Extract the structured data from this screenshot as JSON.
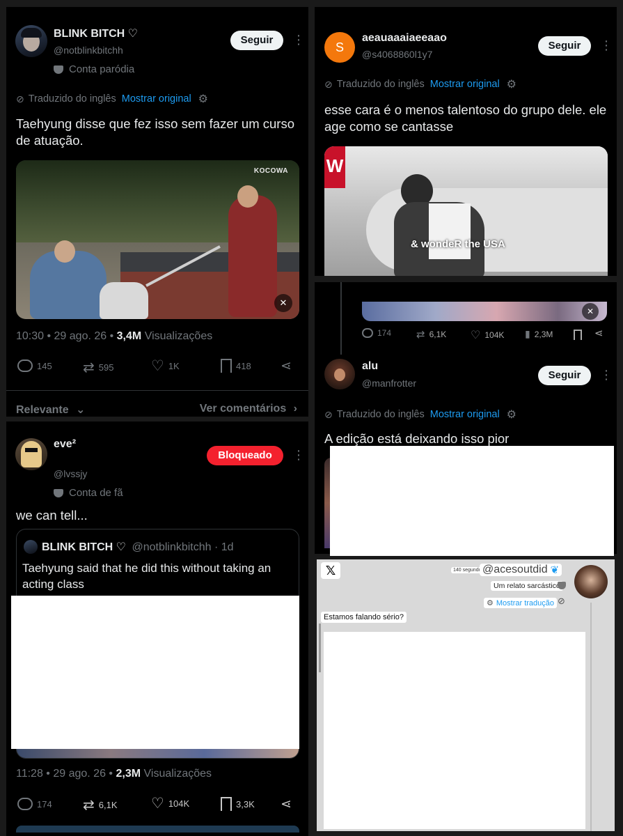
{
  "post1": {
    "name": "BLINK BITCH ♡",
    "handle": "@notblinkbitchh",
    "label": "Conta paródia",
    "follow": "Seguir",
    "translated": "Traduzido do inglês",
    "show_original": "Mostrar original",
    "text": "Taehyung disse que fez isso sem fazer um curso de atuação.",
    "video_watermark": "KOCOWA",
    "time": "10:30 • 29 ago. 26 •",
    "views_count": "3,4M",
    "views_label": "Visualizações",
    "replies": "145",
    "reposts": "595",
    "likes": "1K",
    "bookmarks": "418",
    "sort_label": "Relevante",
    "view_comments": "Ver comentários"
  },
  "post2": {
    "avatar_letter": "S",
    "name": "aeauaaaiaeeaao",
    "handle": "@s4068860l1y7",
    "follow": "Seguir",
    "translated": "Traduzido do inglês",
    "show_original": "Mostrar original",
    "text": "esse cara é o menos talentoso do grupo dele. ele age como se cantasse",
    "video_caption": "& wondeR the USA",
    "brand_letter": "W"
  },
  "post3": {
    "replies": "174",
    "reposts": "6,1K",
    "likes": "104K",
    "views": "2,3M",
    "name": "alu",
    "handle": "@manfrotter",
    "follow": "Seguir",
    "translated": "Traduzido do inglês",
    "show_original": "Mostrar original",
    "text": "A edição está deixando isso pior"
  },
  "post4": {
    "name": "eve²",
    "handle": "@lvssjy",
    "blocked": "Bloqueado",
    "label": "Conta de fã",
    "text": "we can tell...",
    "quote_name": "BLINK BITCH ♡",
    "quote_meta": "@notblinkbitchh · 1d",
    "quote_text": "Taehyung said that he did this without taking an acting class",
    "time": "11:28 • 29 ago. 26 •",
    "views_count": "2,3M",
    "views_label": "Visualizações",
    "replies": "174",
    "reposts": "6,1K",
    "likes": "104K",
    "bookmarks": "3,3K"
  },
  "post5": {
    "time_small": "140 segundos",
    "handle": "@acesoutdid",
    "label": "Um relato sarcástico",
    "show_translation": "Mostrar tradução",
    "text": "Estamos falando sério?"
  }
}
